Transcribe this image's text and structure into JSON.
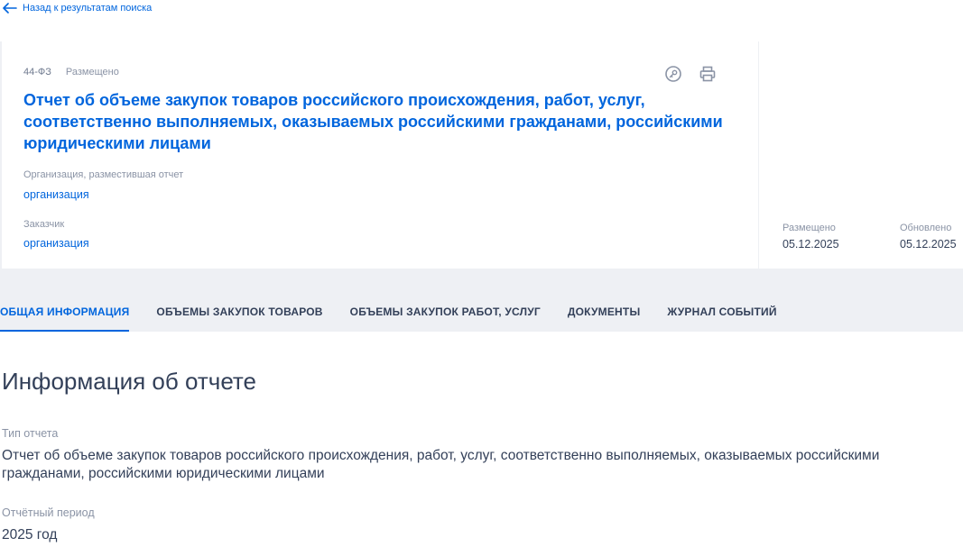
{
  "nav": {
    "back_label": "Назад к результатам поиска"
  },
  "card": {
    "law": "44-ФЗ",
    "status": "Размещено",
    "title": "Отчет об объеме закупок товаров российского происхождения, работ, услуг, соответственно выполняемых, оказываемых российскими гражданами, российскими юридическими лицами",
    "org_label": "Организация, разместившая отчет",
    "org_value": "организация",
    "customer_label": "Заказчик",
    "customer_value": "организация",
    "icons": [
      "key-icon",
      "print-icon"
    ]
  },
  "side": {
    "posted_label": "Размещено",
    "posted_date": "05.12.2025",
    "updated_label": "Обновлено",
    "updated_date": "05.12.2025"
  },
  "tabs": [
    {
      "label": "ОБЩАЯ ИНФОРМАЦИЯ",
      "active": true
    },
    {
      "label": "ОБЪЕМЫ ЗАКУПОК ТОВАРОВ",
      "active": false
    },
    {
      "label": "ОБЪЕМЫ ЗАКУПОК РАБОТ, УСЛУГ",
      "active": false
    },
    {
      "label": "ДОКУМЕНТЫ",
      "active": false
    },
    {
      "label": "ЖУРНАЛ СОБЫТИЙ",
      "active": false
    }
  ],
  "info": {
    "section_title": "Информация об отчете",
    "type_label": "Тип отчета",
    "type_value": "Отчет об объеме закупок товаров российского происхождения, работ, услуг, соответственно выполняемых, оказываемых российскими гражданами, российскими юридическими лицами",
    "period_label": "Отчётный период",
    "period_value": "2025 год"
  },
  "colors": {
    "accent": "#0065dd",
    "text": "#334059",
    "muted": "#8a93a5",
    "background": "#eef0f4"
  }
}
